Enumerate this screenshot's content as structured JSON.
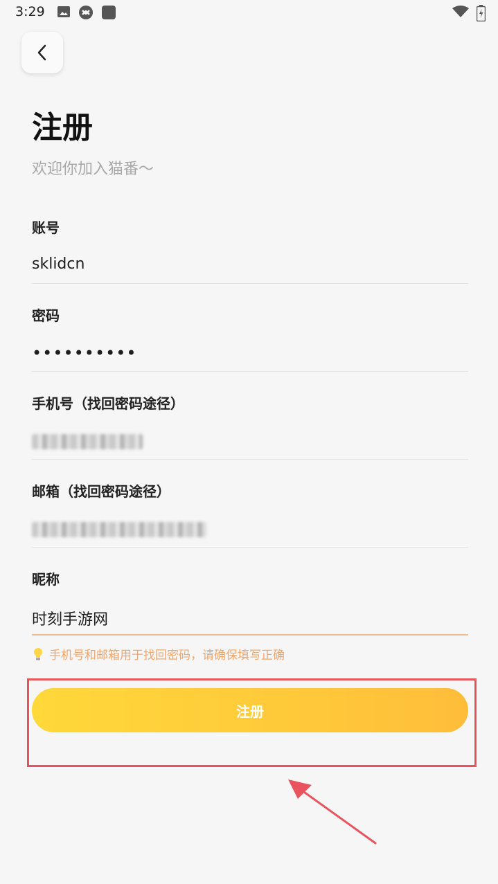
{
  "status_bar": {
    "time": "3:29"
  },
  "page": {
    "title": "注册",
    "subtitle": "欢迎你加入猫番～"
  },
  "form": {
    "account": {
      "label": "账号",
      "value": "sklidcn"
    },
    "password": {
      "label": "密码",
      "value": "••••••••••"
    },
    "phone": {
      "label": "手机号（找回密码途径）"
    },
    "email": {
      "label": "邮箱（找回密码途径）"
    },
    "nickname": {
      "label": "昵称",
      "value": "时刻手游网"
    }
  },
  "hint": {
    "icon": "lightbulb-icon",
    "text": "手机号和邮箱用于找回密码，请确保填写正确"
  },
  "register_button": {
    "label": "注册"
  },
  "colors": {
    "accent": "#ffc93a",
    "hint": "#f0a76d",
    "annotation": "#e8545d"
  }
}
